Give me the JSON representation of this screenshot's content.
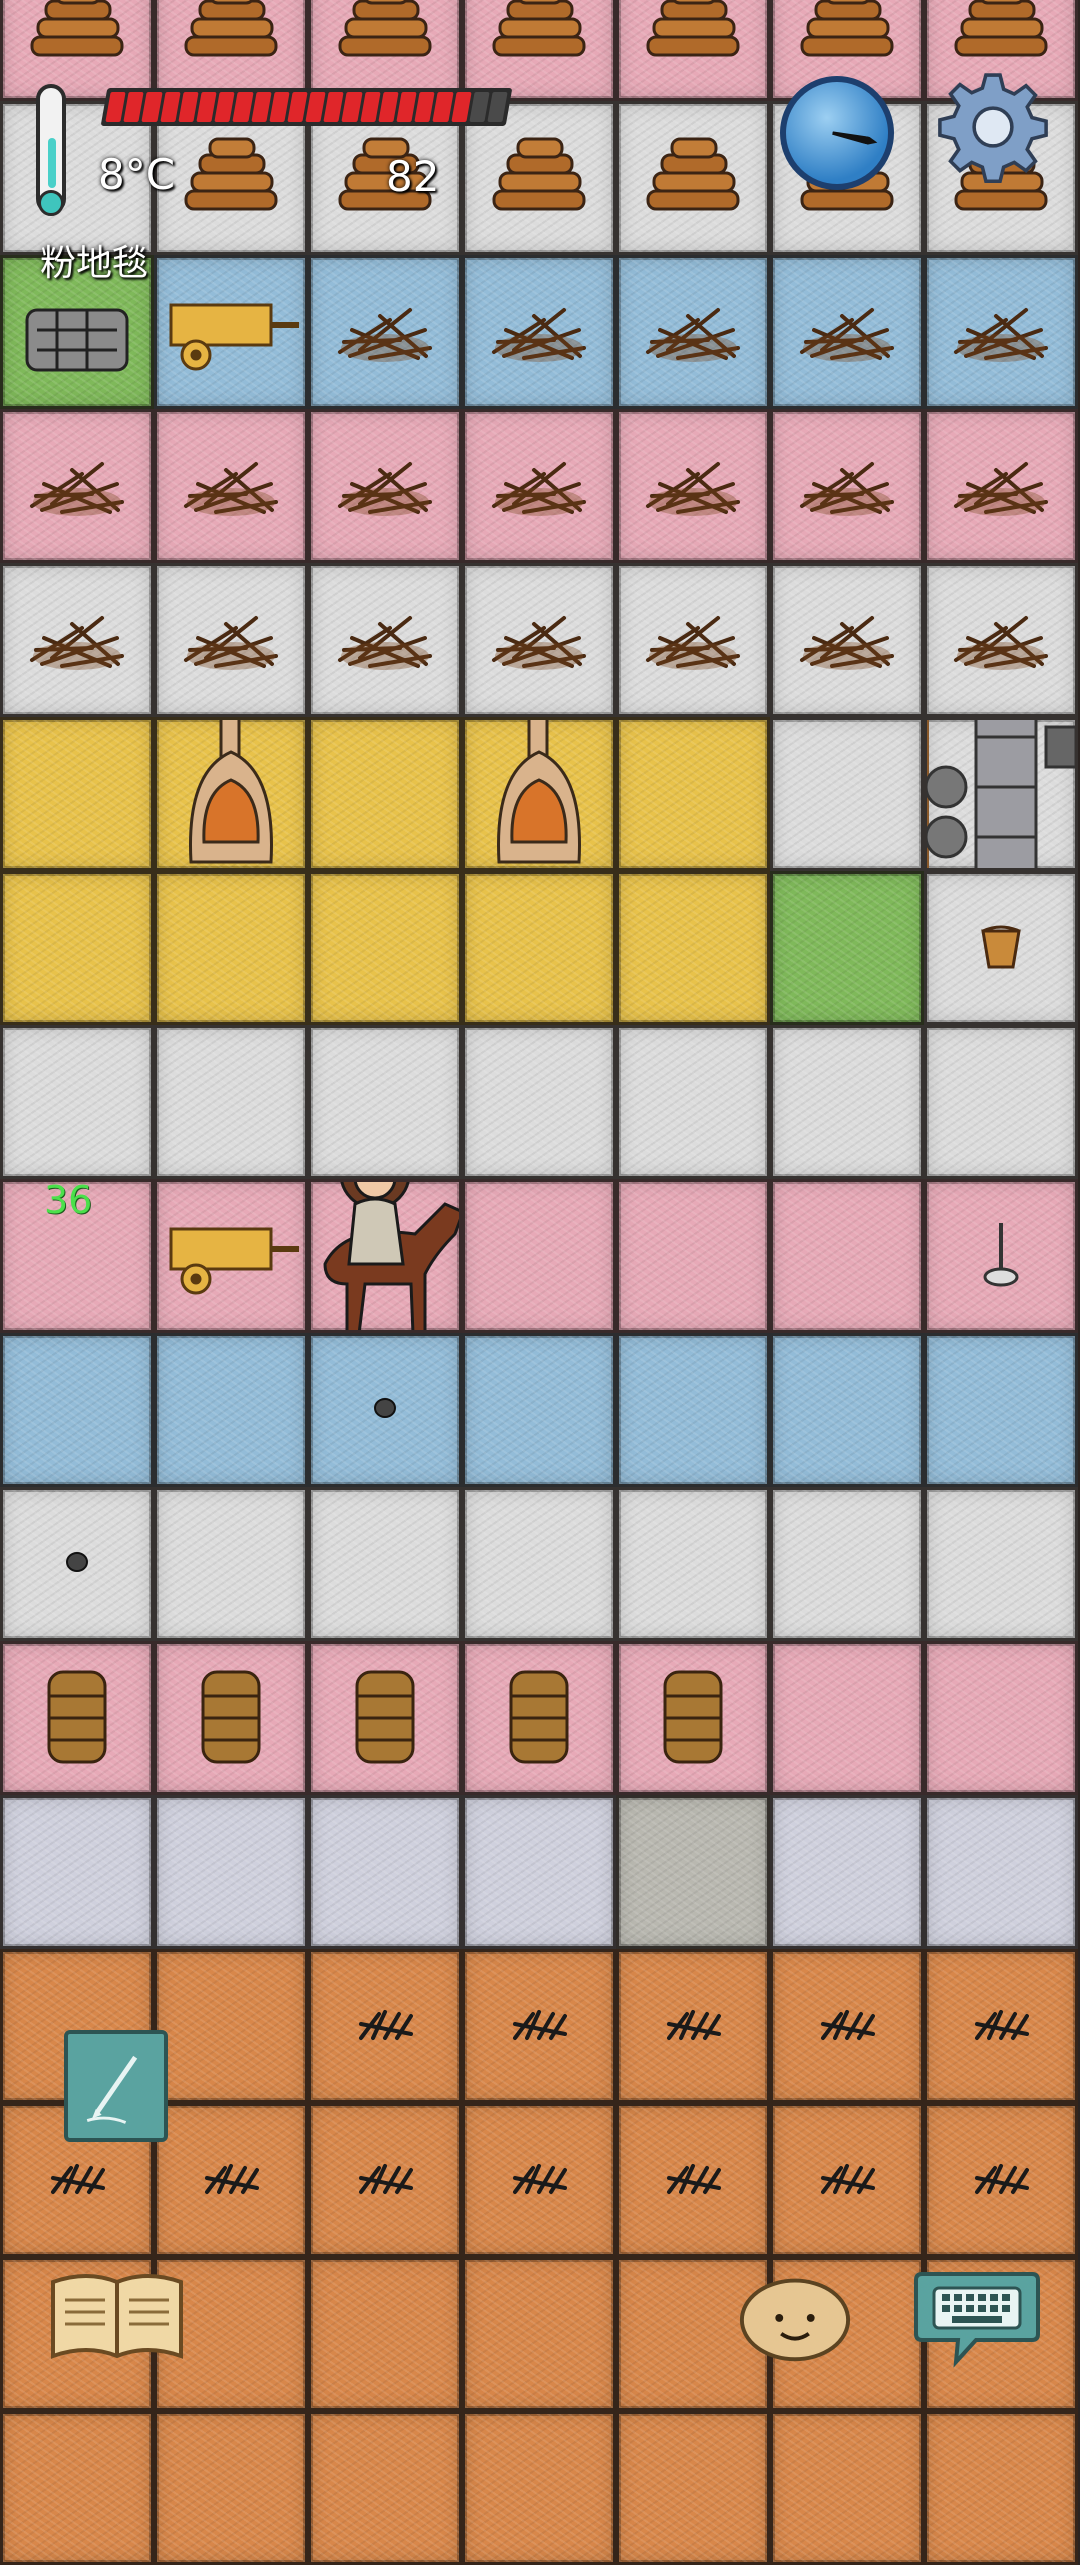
{
  "hud": {
    "temperature": "8°C",
    "holding": "粉地毯",
    "food_value": "82",
    "age": "36",
    "food_segments": [
      1,
      1,
      1,
      1,
      1,
      1,
      1,
      1,
      1,
      1,
      1,
      1,
      1,
      1,
      1,
      1,
      1,
      1,
      1,
      1,
      0,
      0
    ],
    "icons": {
      "thermometer": "thermometer-icon",
      "compass": "compass-icon",
      "settings": "gear-icon",
      "note": "pencil-icon",
      "book": "book-icon",
      "emote": "face-icon",
      "chat": "keyboard-icon"
    }
  },
  "colors": {
    "pink": "#e7a9b7",
    "white": "#dcdcdc",
    "blue": "#93bcd8",
    "yellow": "#e8c24a",
    "stone": "#cfd0dd",
    "orange": "#d8874a",
    "food_bar_red": "#e0262a",
    "age_green": "#4be04b"
  },
  "tiles": [
    "pink",
    "pink",
    "pink",
    "pink",
    "pink",
    "pink",
    "pink",
    "white",
    "white",
    "white",
    "white",
    "white",
    "white",
    "white",
    "grass",
    "blue",
    "blue",
    "blue",
    "blue",
    "blue",
    "blue",
    "pink",
    "pink",
    "pink",
    "pink",
    "pink",
    "pink",
    "pink",
    "white",
    "white",
    "white",
    "white",
    "white",
    "white",
    "white",
    "yellow",
    "yellow",
    "yellow",
    "yellow",
    "yellow",
    "white",
    "white",
    "yellow",
    "yellow",
    "yellow",
    "yellow",
    "yellow",
    "grass",
    "white",
    "white",
    "white",
    "white",
    "white",
    "white",
    "white",
    "white",
    "pink",
    "pink",
    "pink",
    "pink",
    "pink",
    "pink",
    "pink",
    "blue",
    "blue",
    "blue",
    "blue",
    "blue",
    "blue",
    "blue",
    "white",
    "white",
    "white",
    "white",
    "white",
    "white",
    "white",
    "pink",
    "pink",
    "pink",
    "pink",
    "pink",
    "pink",
    "pink",
    "stone",
    "stone",
    "stone",
    "stone",
    "cobble",
    "stone",
    "stone",
    "orange",
    "orange",
    "orange",
    "orange",
    "orange",
    "orange",
    "orange",
    "orange",
    "orange",
    "orange",
    "orange",
    "orange",
    "orange",
    "orange",
    "orange",
    "orange",
    "orange",
    "orange",
    "orange",
    "orange",
    "orange",
    "orange",
    "orange",
    "orange",
    "orange",
    "orange",
    "orange",
    "orange"
  ],
  "objects": [
    {
      "tile": 0,
      "kind": "firewood"
    },
    {
      "tile": 1,
      "kind": "firewood"
    },
    {
      "tile": 2,
      "kind": "firewood"
    },
    {
      "tile": 3,
      "kind": "firewood"
    },
    {
      "tile": 4,
      "kind": "firewood"
    },
    {
      "tile": 5,
      "kind": "firewood"
    },
    {
      "tile": 6,
      "kind": "firewood"
    },
    {
      "tile": 8,
      "kind": "firewood"
    },
    {
      "tile": 9,
      "kind": "firewood"
    },
    {
      "tile": 10,
      "kind": "firewood"
    },
    {
      "tile": 11,
      "kind": "firewood"
    },
    {
      "tile": 12,
      "kind": "firewood"
    },
    {
      "tile": 13,
      "kind": "firewood"
    },
    {
      "tile": 14,
      "kind": "well"
    },
    {
      "tile": 15,
      "kind": "cart"
    },
    {
      "tile": 16,
      "kind": "kindling"
    },
    {
      "tile": 17,
      "kind": "kindling"
    },
    {
      "tile": 18,
      "kind": "kindling"
    },
    {
      "tile": 19,
      "kind": "kindling"
    },
    {
      "tile": 20,
      "kind": "kindling"
    },
    {
      "tile": 21,
      "kind": "kindling"
    },
    {
      "tile": 22,
      "kind": "kindling"
    },
    {
      "tile": 23,
      "kind": "kindling"
    },
    {
      "tile": 24,
      "kind": "kindling"
    },
    {
      "tile": 25,
      "kind": "kindling"
    },
    {
      "tile": 26,
      "kind": "kindling"
    },
    {
      "tile": 27,
      "kind": "kindling"
    },
    {
      "tile": 28,
      "kind": "kindling"
    },
    {
      "tile": 29,
      "kind": "kindling"
    },
    {
      "tile": 30,
      "kind": "kindling"
    },
    {
      "tile": 31,
      "kind": "kindling"
    },
    {
      "tile": 32,
      "kind": "kindling"
    },
    {
      "tile": 33,
      "kind": "kindling"
    },
    {
      "tile": 34,
      "kind": "kindling"
    },
    {
      "tile": 36,
      "kind": "kiln"
    },
    {
      "tile": 38,
      "kind": "kiln"
    },
    {
      "tile": 41,
      "kind": "newcomen"
    },
    {
      "tile": 48,
      "kind": "bucket"
    },
    {
      "tile": 57,
      "kind": "cart"
    },
    {
      "tile": 58,
      "kind": "horse-rider"
    },
    {
      "tile": 62,
      "kind": "spindle"
    },
    {
      "tile": 65,
      "kind": "stone"
    },
    {
      "tile": 70,
      "kind": "stone"
    },
    {
      "tile": 77,
      "kind": "basket"
    },
    {
      "tile": 78,
      "kind": "basket"
    },
    {
      "tile": 79,
      "kind": "basket"
    },
    {
      "tile": 80,
      "kind": "basket"
    },
    {
      "tile": 81,
      "kind": "basket"
    },
    {
      "tile": 93,
      "kind": "weed"
    },
    {
      "tile": 94,
      "kind": "weed"
    },
    {
      "tile": 95,
      "kind": "weed"
    },
    {
      "tile": 96,
      "kind": "weed"
    },
    {
      "tile": 97,
      "kind": "weed"
    },
    {
      "tile": 98,
      "kind": "weed"
    },
    {
      "tile": 99,
      "kind": "weed"
    },
    {
      "tile": 100,
      "kind": "weed"
    },
    {
      "tile": 101,
      "kind": "weed"
    },
    {
      "tile": 102,
      "kind": "weed"
    },
    {
      "tile": 103,
      "kind": "weed"
    },
    {
      "tile": 104,
      "kind": "weed"
    }
  ]
}
